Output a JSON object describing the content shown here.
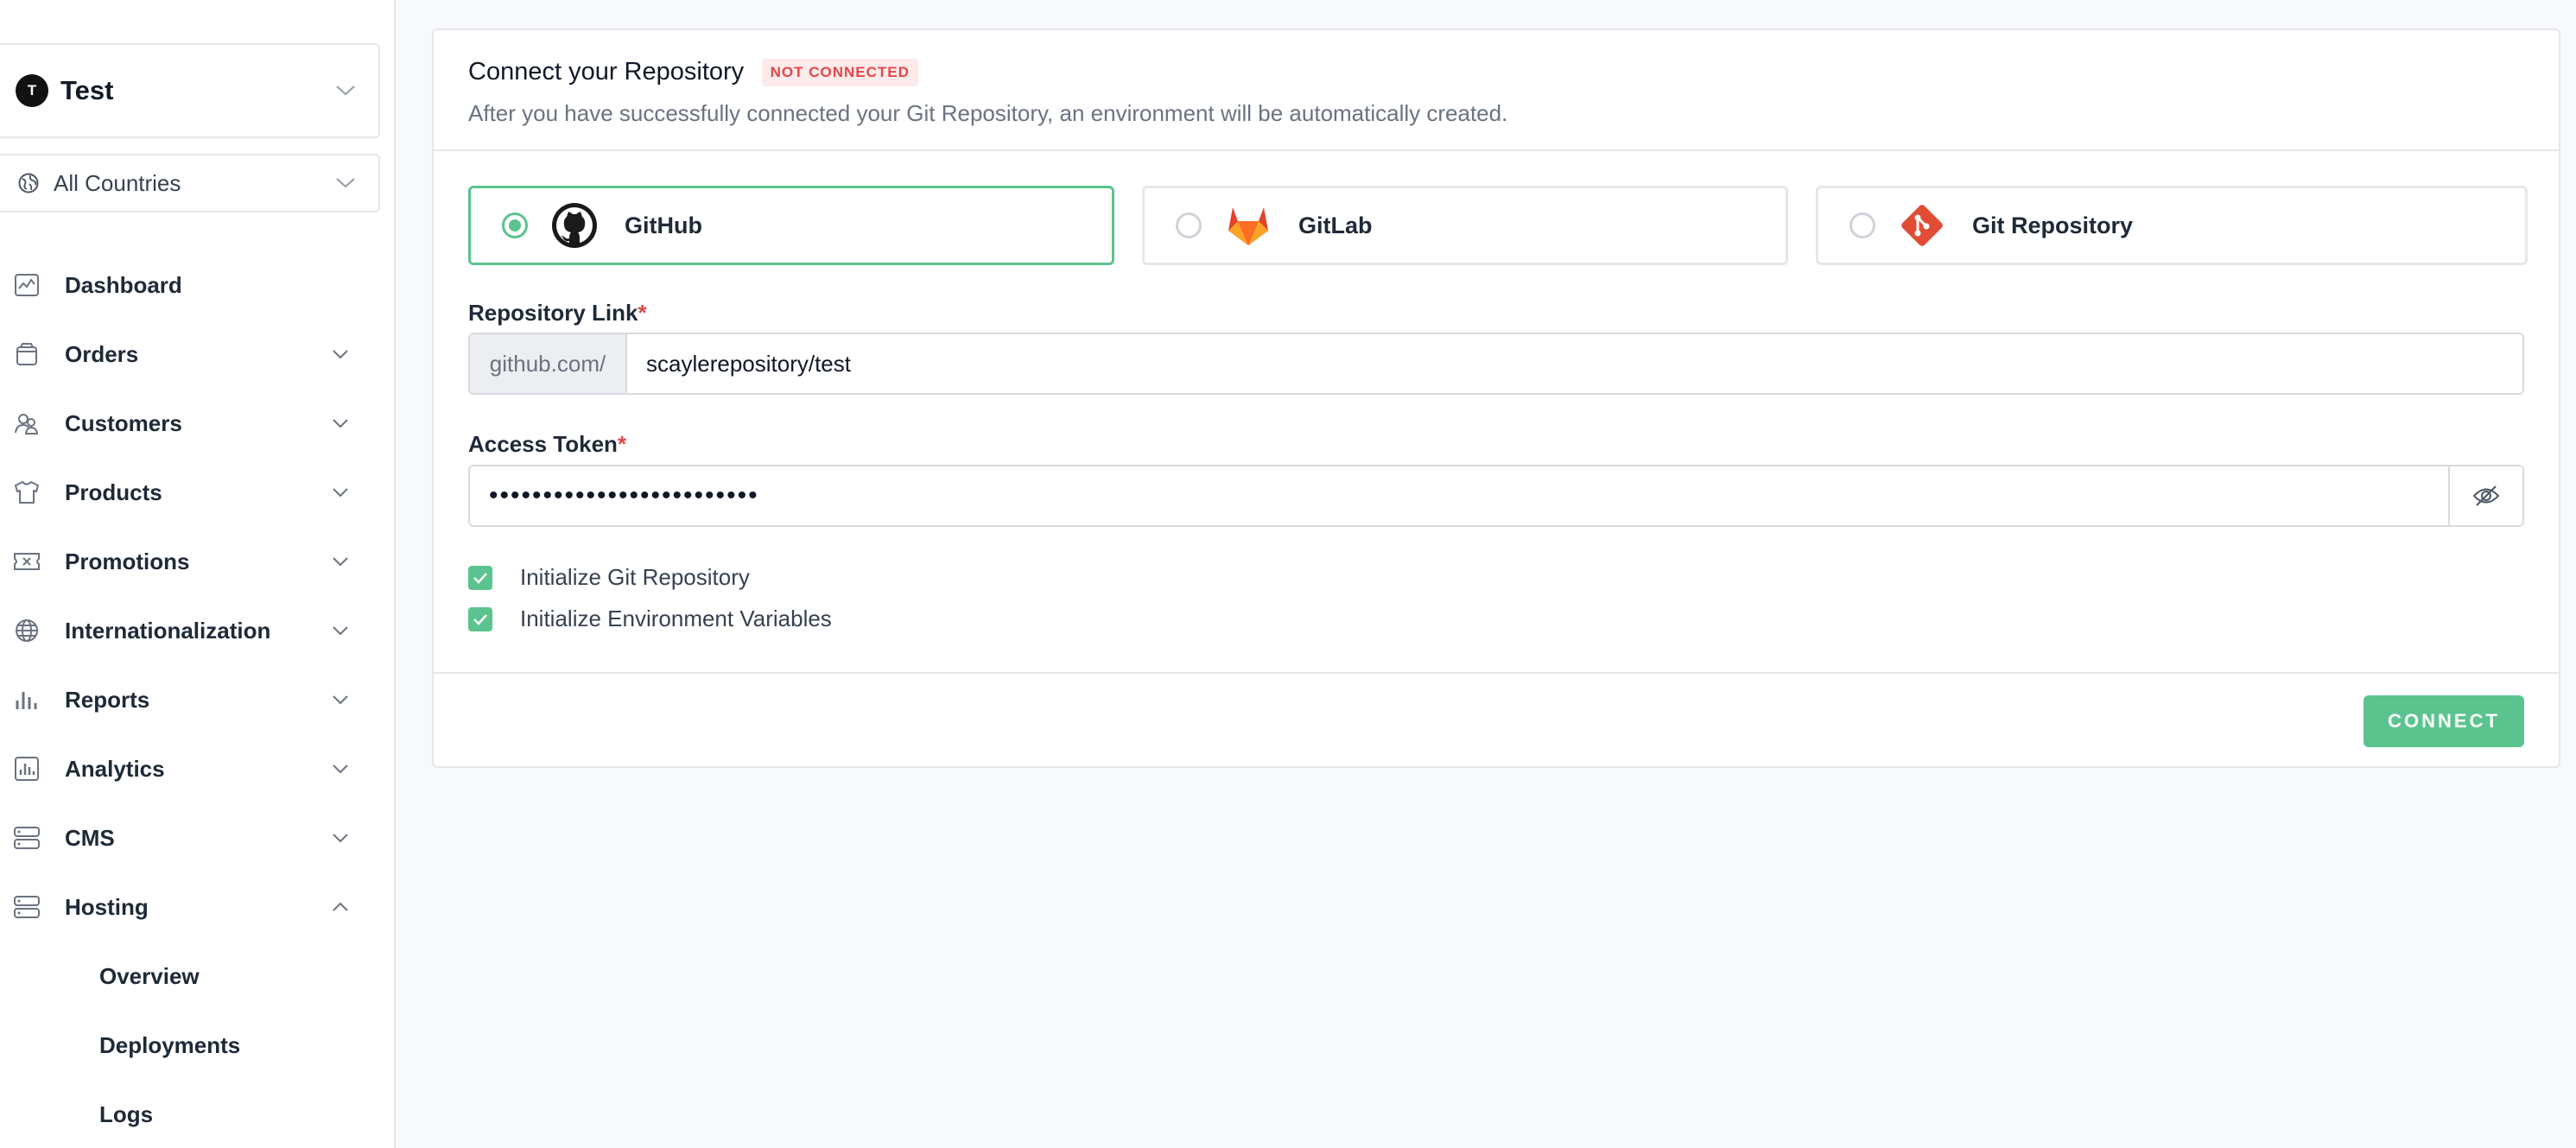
{
  "store": {
    "avatar_letter": "T",
    "name": "Test"
  },
  "country_filter": {
    "label": "All Countries"
  },
  "nav": {
    "items": [
      {
        "label": "Dashboard",
        "icon": "chart-activity-icon"
      },
      {
        "label": "Orders",
        "icon": "shopping-bag-icon"
      },
      {
        "label": "Customers",
        "icon": "users-icon"
      },
      {
        "label": "Products",
        "icon": "shirt-icon"
      },
      {
        "label": "Promotions",
        "icon": "ticket-icon"
      },
      {
        "label": "Internationalization",
        "icon": "globe-icon"
      },
      {
        "label": "Reports",
        "icon": "bar-chart-icon"
      },
      {
        "label": "Analytics",
        "icon": "analytics-icon"
      },
      {
        "label": "CMS",
        "icon": "server-icon"
      },
      {
        "label": "Hosting",
        "icon": "server-icon"
      }
    ],
    "hosting_sub": [
      {
        "label": "Overview"
      },
      {
        "label": "Deployments"
      },
      {
        "label": "Logs"
      }
    ]
  },
  "card": {
    "title": "Connect your Repository",
    "badge": "NOT CONNECTED",
    "subtitle": "After you have successfully connected your Git Repository, an environment will be automatically created."
  },
  "providers": [
    {
      "label": "GitHub",
      "selected": true,
      "icon": "github-icon"
    },
    {
      "label": "GitLab",
      "selected": false,
      "icon": "gitlab-icon"
    },
    {
      "label": "Git Repository",
      "selected": false,
      "icon": "git-icon"
    }
  ],
  "repo": {
    "label": "Repository Link",
    "required_mark": "*",
    "prefix": "github.com/",
    "value": "scaylerepository/test"
  },
  "token": {
    "label": "Access Token",
    "required_mark": "*",
    "value": "•••••••••••••••••••••••••"
  },
  "checks": [
    {
      "label": "Initialize Git Repository",
      "checked": true
    },
    {
      "label": "Initialize Environment Variables",
      "checked": true
    }
  ],
  "actions": {
    "connect": "CONNECT"
  },
  "colors": {
    "accent": "#5bc48e",
    "danger": "#e04848",
    "badge_bg": "#fdeaea"
  }
}
